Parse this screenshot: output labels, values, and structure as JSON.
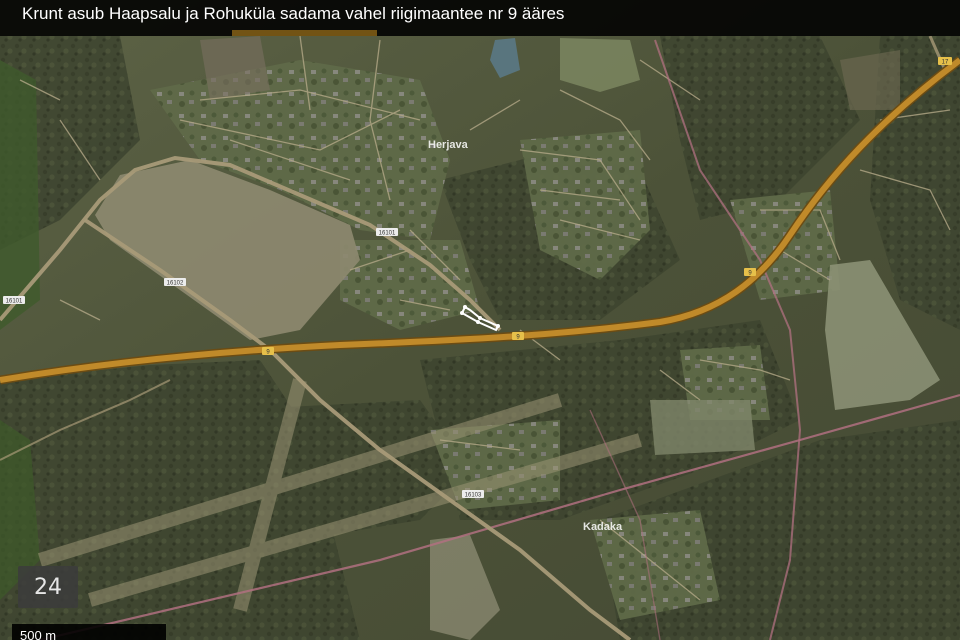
{
  "header": {
    "title": "Krunt asub Haapsalu ja Rohuküla sadama vahel riigimaantee nr 9 ääres"
  },
  "map": {
    "zoom_level": "24",
    "scale_label": "500 m",
    "place_labels": {
      "herjava": "Herjava",
      "kadaka": "Kadaka"
    },
    "road_numbers": {
      "main_west": "9",
      "main_center": "9",
      "main_east": "9",
      "main_ne": "17",
      "r16101_a": "16101",
      "r16101_b": "16101",
      "r16102": "16102",
      "r16103": "16103"
    },
    "colors": {
      "main_road": "#c08a2a",
      "secondary_road": "#a89a78",
      "railway": "#b07080",
      "parcel_outline": "#ffffff"
    }
  }
}
